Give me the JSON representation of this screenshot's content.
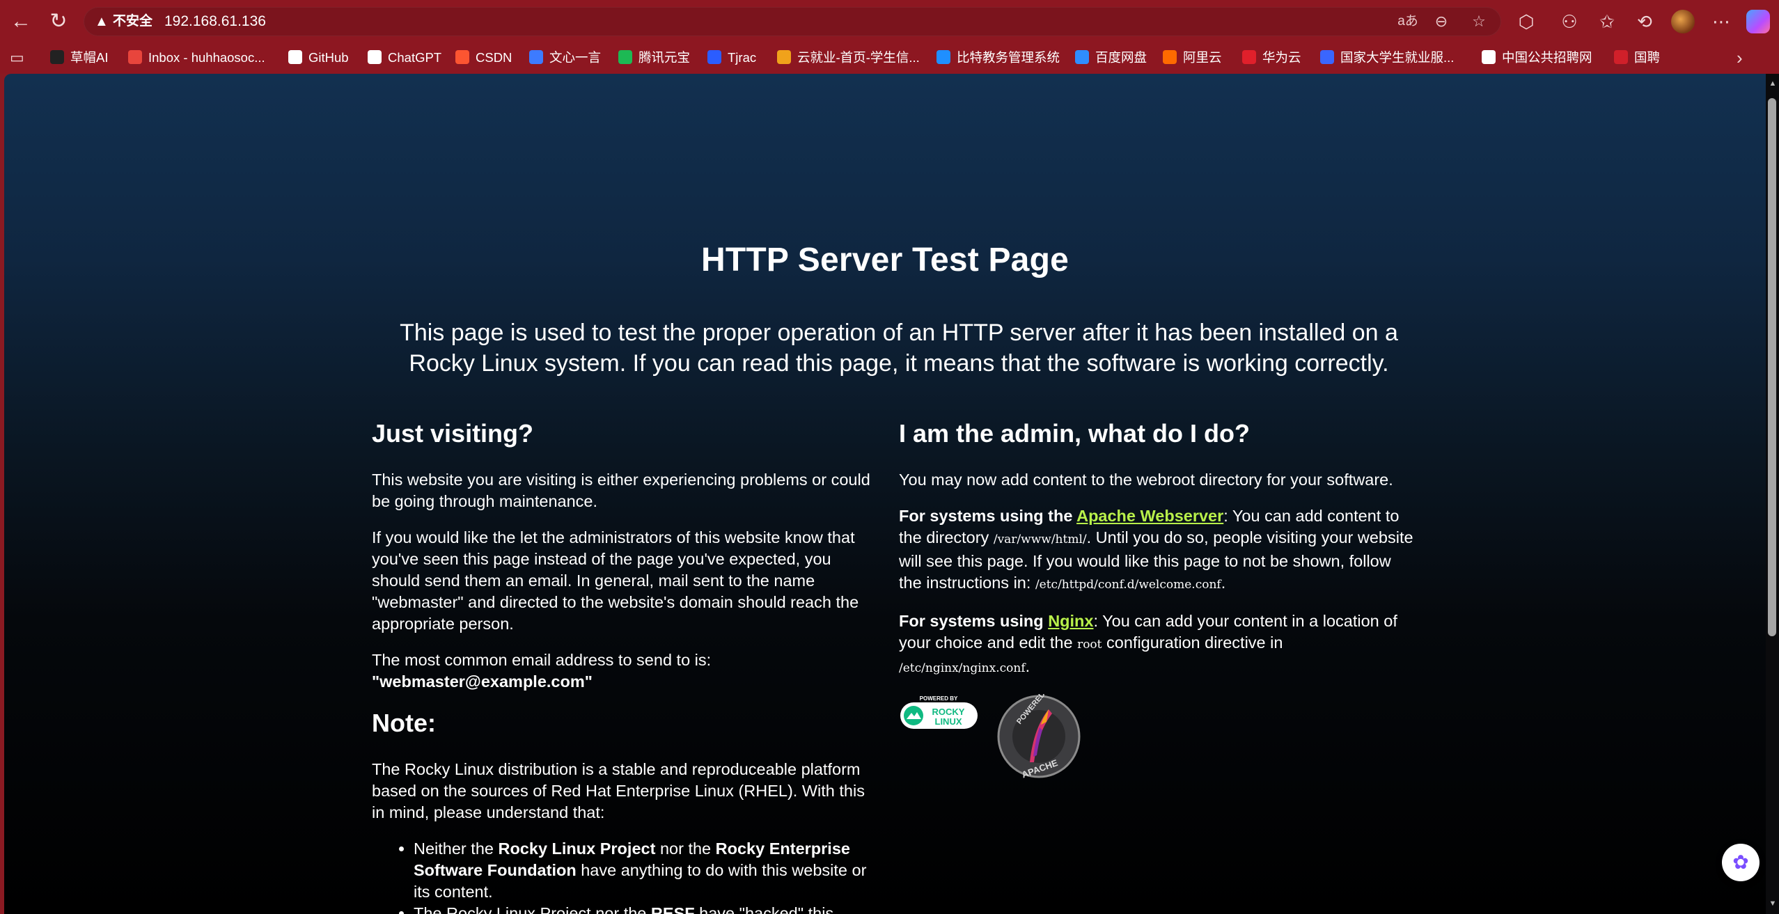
{
  "browser": {
    "security_label": "不安全",
    "url": "192.168.61.136",
    "bookmarks": [
      {
        "label": "草帽AI",
        "color": "#222222"
      },
      {
        "label": "Inbox - huhhaosoc...",
        "color": "#e8453c"
      },
      {
        "label": "GitHub",
        "color": "#ffffff"
      },
      {
        "label": "ChatGPT",
        "color": "#ffffff"
      },
      {
        "label": "CSDN",
        "color": "#fc5531"
      },
      {
        "label": "文心一言",
        "color": "#3d7bff"
      },
      {
        "label": "腾讯元宝",
        "color": "#1db954"
      },
      {
        "label": "Tjrac",
        "color": "#2b5dff"
      },
      {
        "label": "云就业-首页-学生信...",
        "color": "#f0a21b"
      },
      {
        "label": "比特教务管理系统",
        "color": "#1f8fff"
      },
      {
        "label": "百度网盘",
        "color": "#2f8dff"
      },
      {
        "label": "阿里云",
        "color": "#ff6a00"
      },
      {
        "label": "华为云",
        "color": "#e0202b"
      },
      {
        "label": "国家大学生就业服...",
        "color": "#3a66ff"
      },
      {
        "label": "中国公共招聘网",
        "color": "#ffffff"
      },
      {
        "label": "国聘",
        "color": "#d0202a"
      }
    ]
  },
  "page": {
    "title": "HTTP Server Test Page",
    "lead": "This page is used to test the proper operation of an HTTP server after it has been installed on a Rocky Linux system. If you can read this page, it means that the software is working correctly.",
    "left": {
      "heading": "Just visiting?",
      "p1": "This website you are visiting is either experiencing problems or could be going through maintenance.",
      "p2": "If you would like the let the administrators of this website know that you've seen this page instead of the page you've expected, you should send them an email. In general, mail sent to the name \"webmaster\" and directed to the website's domain should reach the appropriate person.",
      "p3_text": "The most common email address to send to is:",
      "p3_email": "\"webmaster@example.com\"",
      "note_heading": "Note:",
      "note_p": "The Rocky Linux distribution is a stable and reproduceable platform based on the sources of Red Hat Enterprise Linux (RHEL). With this in mind, please understand that:",
      "li1": {
        "a": "Neither the ",
        "b": "Rocky Linux Project",
        "c": " nor the ",
        "d": "Rocky Enterprise Software Foundation",
        "e": " have anything to do with this website or its content."
      },
      "li2": {
        "a": "The Rocky Linux Project nor the ",
        "b": "RESF",
        "c": " have \"hacked\" this"
      }
    },
    "right": {
      "heading": "I am the admin, what do I do?",
      "p1": "You may now add content to the webroot directory for your software.",
      "apache": {
        "lead": "For systems using the ",
        "link": "Apache Webserver",
        "t1": ": You can add content to the directory ",
        "code1": "/var/www/html/",
        "t2": ". Until you do so, people visiting your website will see this page. If you would like this page to not be shown, follow the instructions in: ",
        "code2": "/etc/httpd/conf.d/welcome.conf",
        "t3": "."
      },
      "nginx": {
        "lead": "For systems using ",
        "link": "Nginx",
        "t1": ": You can add your content in a location of your choice and edit the ",
        "code1": "root",
        "t2": " configuration directive in ",
        "code2": "/etc/nginx/nginx.conf",
        "t3": "."
      },
      "logo_rocky": {
        "top": "POWERED BY",
        "line1": "ROCKY",
        "line2": "LINUX"
      },
      "logo_apache": {
        "top": "POWERED BY",
        "bottom": "APACHE"
      }
    }
  },
  "colors": {
    "chrome": "#8d1721",
    "link": "#b8f04a",
    "rocky_green": "#10b981"
  }
}
